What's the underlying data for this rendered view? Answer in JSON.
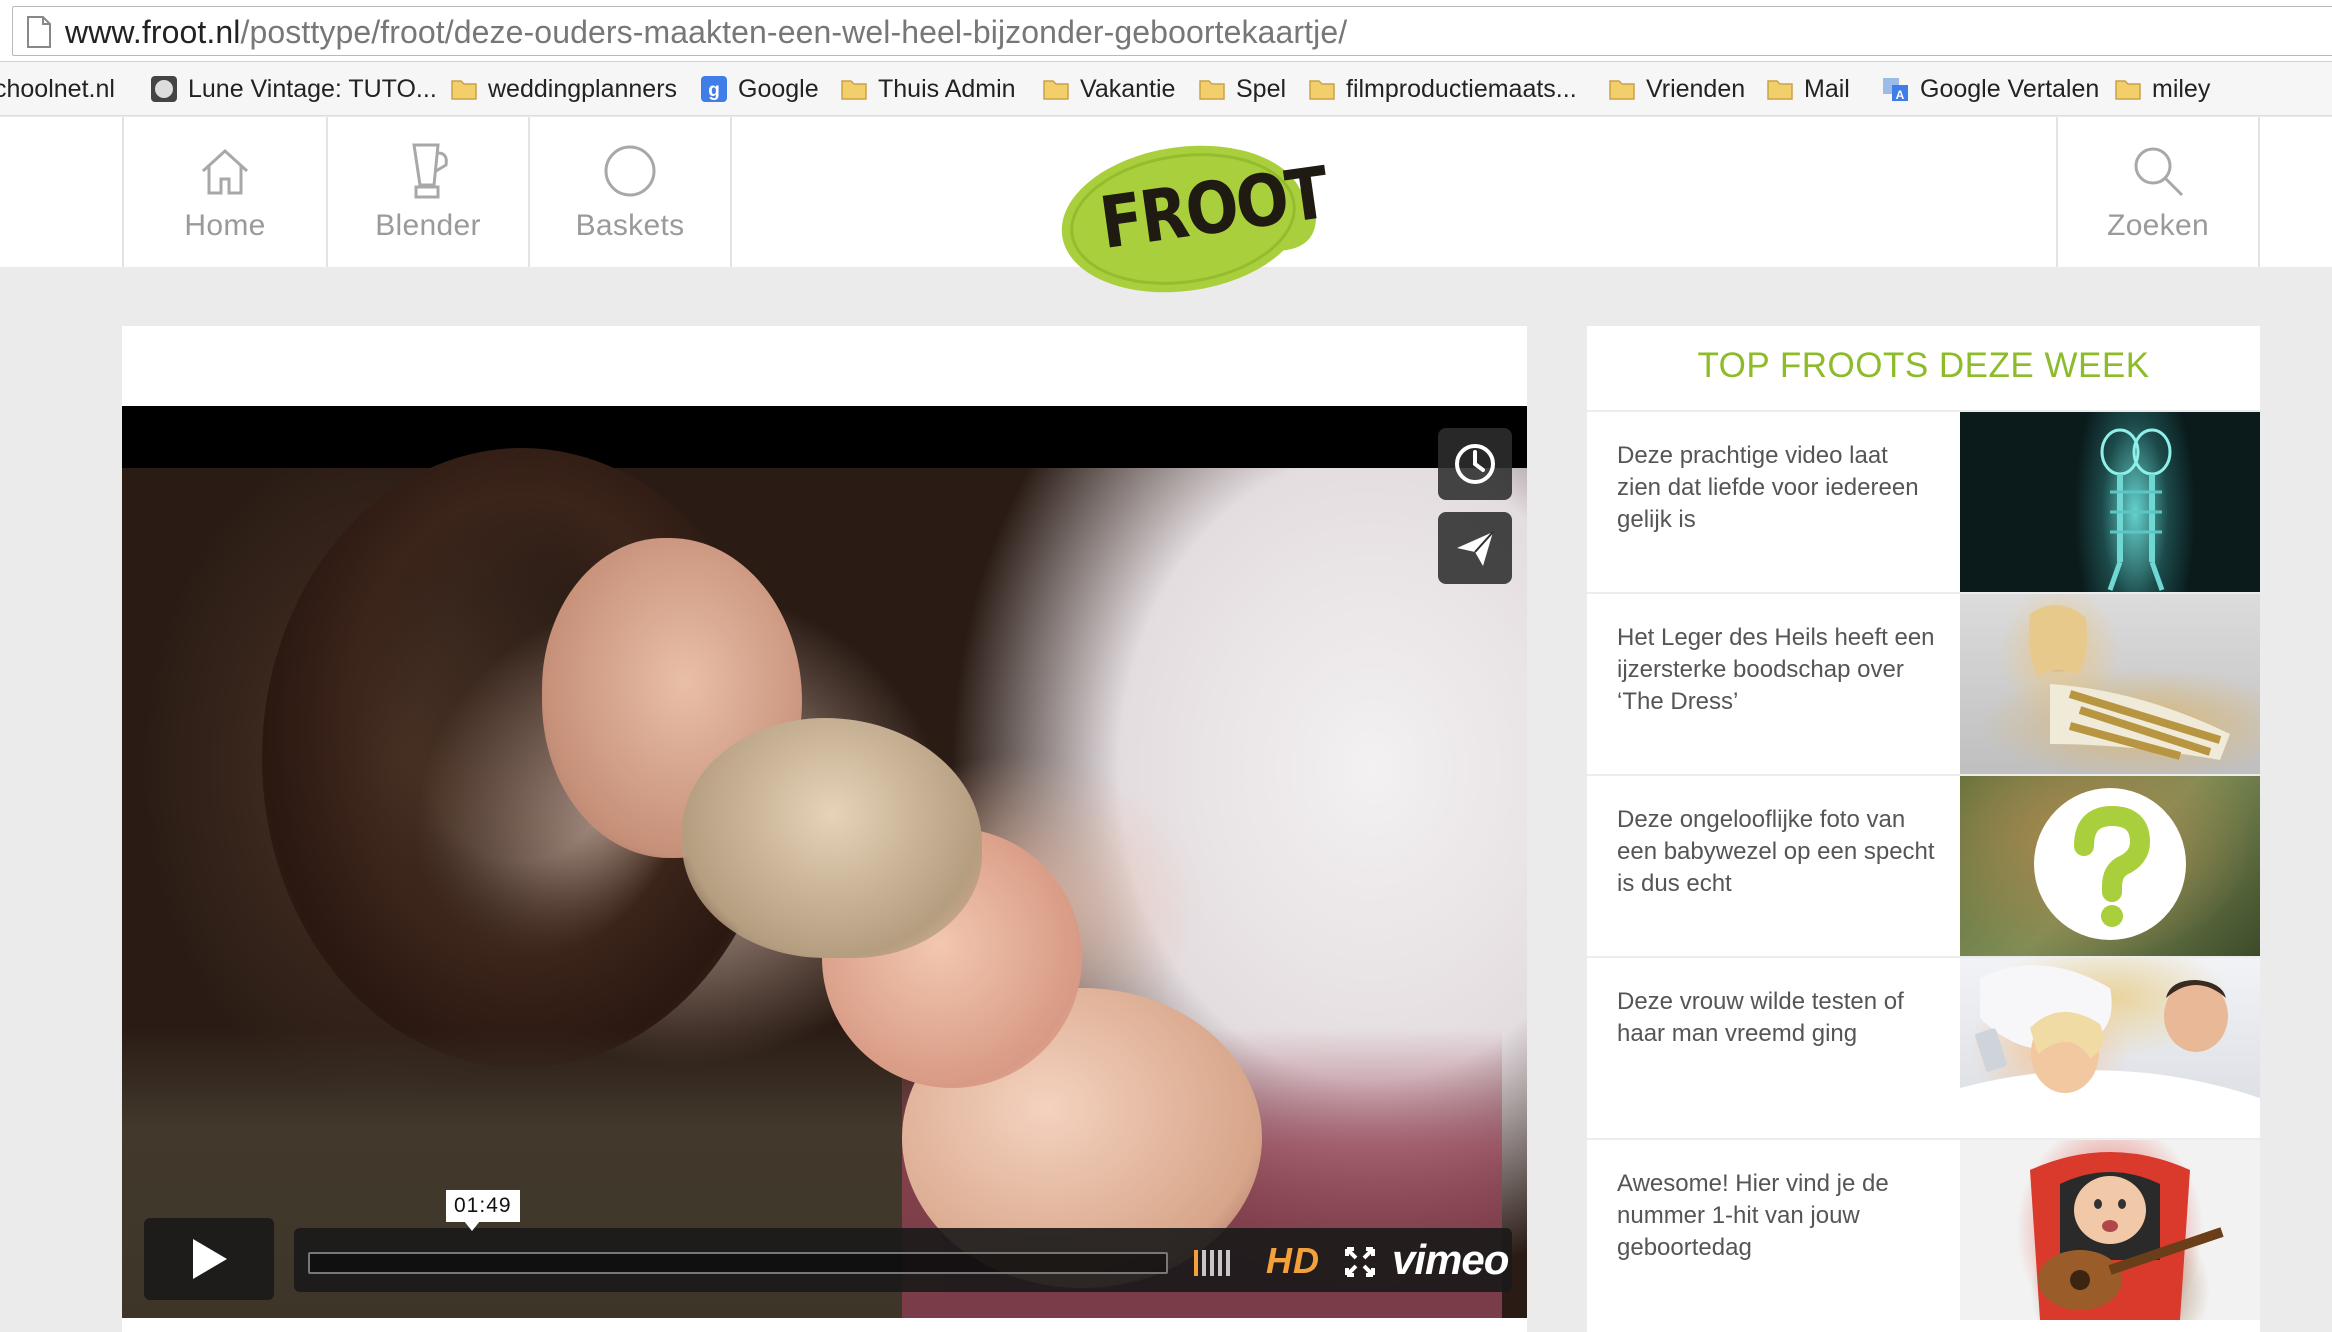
{
  "browser": {
    "url_host": "www.froot.nl",
    "url_path": "/posttype/froot/deze-ouders-maakten-een-wel-heel-bijzonder-geboortekaartje/",
    "bookmarks": [
      {
        "label": "choolnet.nl",
        "icon": "none"
      },
      {
        "label": "Lune Vintage: TUTO...",
        "icon": "site-icon"
      },
      {
        "label": "weddingplanners",
        "icon": "folder-icon"
      },
      {
        "label": "Google",
        "icon": "google-icon"
      },
      {
        "label": "Thuis Admin",
        "icon": "folder-icon"
      },
      {
        "label": "Vakantie",
        "icon": "folder-icon"
      },
      {
        "label": "Spel",
        "icon": "folder-icon"
      },
      {
        "label": "filmproductiemaats...",
        "icon": "folder-icon"
      },
      {
        "label": "Vrienden",
        "icon": "folder-icon"
      },
      {
        "label": "Mail",
        "icon": "folder-icon"
      },
      {
        "label": "Google Vertalen",
        "icon": "translate-icon"
      },
      {
        "label": "miley",
        "icon": "folder-icon"
      }
    ]
  },
  "header": {
    "nav": [
      {
        "label": "Home",
        "icon": "home-icon"
      },
      {
        "label": "Blender",
        "icon": "blender-icon"
      },
      {
        "label": "Baskets",
        "icon": "circle-icon"
      }
    ],
    "logo_text": "FROOT",
    "search_label": "Zoeken"
  },
  "video": {
    "timecode": "01:49",
    "hd_label": "HD",
    "provider": "vimeo",
    "volume_level": 0.2
  },
  "sidebar": {
    "title": "TOP FROOTS DEZE WEEK",
    "stories": [
      {
        "text": "Deze prachtige video laat zien dat liefde voor iedereen gelijk is",
        "thumb": "xray-couple"
      },
      {
        "text": "Het Leger des Heils heeft een ijzersterke boodschap over ‘The Dress’",
        "thumb": "woman-in-dress"
      },
      {
        "text": "Deze ongelooflijke foto van een babywezel op een specht is dus echt",
        "thumb": "question-mark"
      },
      {
        "text": "Deze vrouw wilde testen of haar man vreemd ging",
        "thumb": "couple-in-bed"
      },
      {
        "text": "Awesome! Hier vind je de nummer 1-hit van jouw geboortedag",
        "thumb": "baby-with-guitar"
      }
    ]
  },
  "colors": {
    "accent_green": "#8dbb2a",
    "logo_green": "#a9cf3c",
    "vimeo_orange": "#f4a13b"
  }
}
